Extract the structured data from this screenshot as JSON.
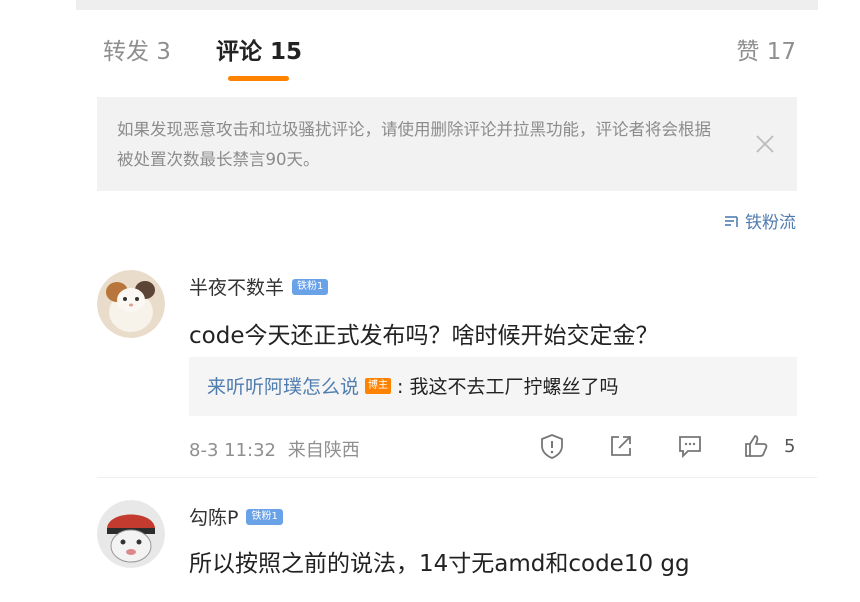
{
  "tabs": {
    "repost": "转发 3",
    "comments": "评论 15",
    "likes": "赞 17"
  },
  "notice": {
    "text": "如果发现恶意攻击和垃圾骚扰评论，请使用删除评论并拉黑功能，评论者将会根据被处置次数最长禁言90天。"
  },
  "sort": {
    "label": "铁粉流"
  },
  "comments": [
    {
      "user": "半夜不数羊",
      "badge": "铁粉1",
      "text": "code今天还正式发布吗？啥时候开始交定金？",
      "reply": {
        "user": "来听听阿璞怎么说",
        "tag": "博主",
        "text": ": 我这不去工厂拧螺丝了吗"
      },
      "time": "8-3 11:32",
      "location": "来自陕西",
      "likes": "5"
    },
    {
      "user": "勾陈P",
      "badge": "铁粉1",
      "text": "所以按照之前的说法，14寸无amd和code10 gg"
    }
  ],
  "colors": {
    "accent": "#ff8200",
    "link": "#507daf",
    "badge": "#6aa2e8"
  }
}
